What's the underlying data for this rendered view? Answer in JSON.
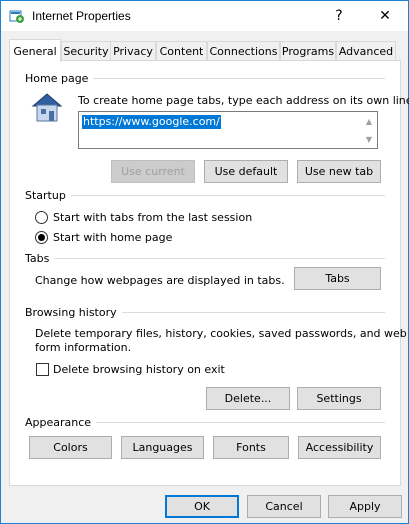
{
  "window": {
    "title": "Internet Properties",
    "help_glyph": "?",
    "close_glyph": "✕"
  },
  "tabs": [
    {
      "label": "General",
      "active": true
    },
    {
      "label": "Security"
    },
    {
      "label": "Privacy"
    },
    {
      "label": "Content"
    },
    {
      "label": "Connections"
    },
    {
      "label": "Programs"
    },
    {
      "label": "Advanced"
    }
  ],
  "home_page": {
    "group_label": "Home page",
    "instruction": "To create home page tabs, type each address on its own line.",
    "url_value": "https://www.google.com/",
    "use_current": "Use current",
    "use_default": "Use default",
    "use_new_tab": "Use new tab"
  },
  "startup": {
    "group_label": "Startup",
    "option_last_session": "Start with tabs from the last session",
    "option_home_page": "Start with home page",
    "selected": "home_page"
  },
  "tabs_group": {
    "group_label": "Tabs",
    "description": "Change how webpages are displayed in tabs.",
    "tabs_button": "Tabs"
  },
  "browsing_history": {
    "group_label": "Browsing history",
    "description_line1": "Delete temporary files, history, cookies, saved passwords, and web",
    "description_line2": "form information.",
    "delete_on_exit_label": "Delete browsing history on exit",
    "delete_on_exit_checked": false,
    "delete_button": "Delete...",
    "settings_button": "Settings"
  },
  "appearance": {
    "group_label": "Appearance",
    "colors": "Colors",
    "languages": "Languages",
    "fonts": "Fonts",
    "accessibility": "Accessibility"
  },
  "footer": {
    "ok": "OK",
    "cancel": "Cancel",
    "apply": "Apply"
  },
  "colors": {
    "accent": "#0078d7",
    "window_border": "#1883d7",
    "dialog_bg": "#f0f0f0"
  }
}
